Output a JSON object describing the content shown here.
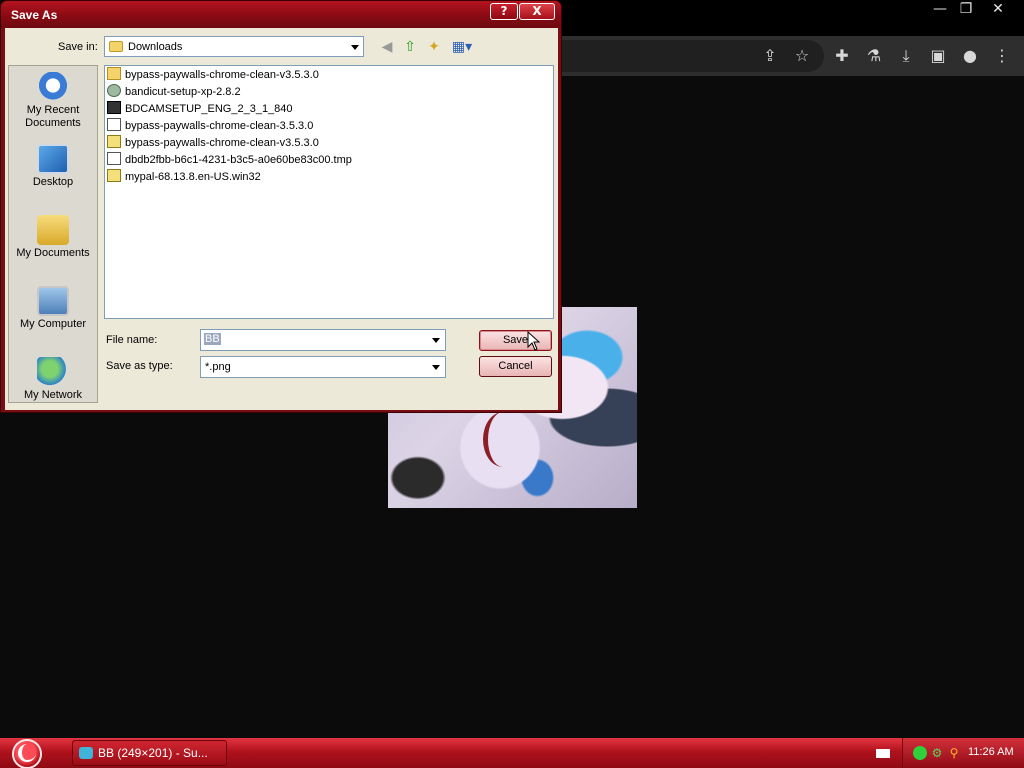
{
  "browser": {
    "window_controls": {
      "minimize": "—",
      "restore": "❐",
      "close": "✕"
    },
    "toolbar_icons": [
      "share-icon",
      "star-icon",
      "extensions-icon",
      "labs-icon",
      "download-icon",
      "sidepanel-icon",
      "profile-icon",
      "menu-icon"
    ]
  },
  "dialog": {
    "title": "Save As",
    "help_label": "?",
    "close_label": "X",
    "save_in_label": "Save in:",
    "save_in_value": "Downloads",
    "places": [
      {
        "label": "My Recent Documents",
        "icon": "recent-documents-icon"
      },
      {
        "label": "Desktop",
        "icon": "desktop-icon"
      },
      {
        "label": "My Documents",
        "icon": "my-documents-icon"
      },
      {
        "label": "My Computer",
        "icon": "my-computer-icon"
      },
      {
        "label": "My Network",
        "icon": "my-network-icon"
      }
    ],
    "files": [
      {
        "name": "bypass-paywalls-chrome-clean-v3.5.3.0",
        "type": "folder"
      },
      {
        "name": "bandicut-setup-xp-2.8.2",
        "type": "exe"
      },
      {
        "name": "BDCAMSETUP_ENG_2_3_1_840",
        "type": "bdc"
      },
      {
        "name": "bypass-paywalls-chrome-clean-3.5.3.0",
        "type": "doc"
      },
      {
        "name": "bypass-paywalls-chrome-clean-v3.5.3.0",
        "type": "zip"
      },
      {
        "name": "dbdb2fbb-b6c1-4231-b3c5-a0e60be83c00.tmp",
        "type": "doc"
      },
      {
        "name": "mypal-68.13.8.en-US.win32",
        "type": "zip"
      }
    ],
    "file_name_label": "File name:",
    "file_name_value": "BB",
    "save_type_label": "Save as type:",
    "save_type_value": "*.png",
    "save_button": "Save",
    "cancel_button": "Cancel"
  },
  "taskbar": {
    "task_label": "BB (249×201) - Su...",
    "clock": "11:26 AM"
  }
}
